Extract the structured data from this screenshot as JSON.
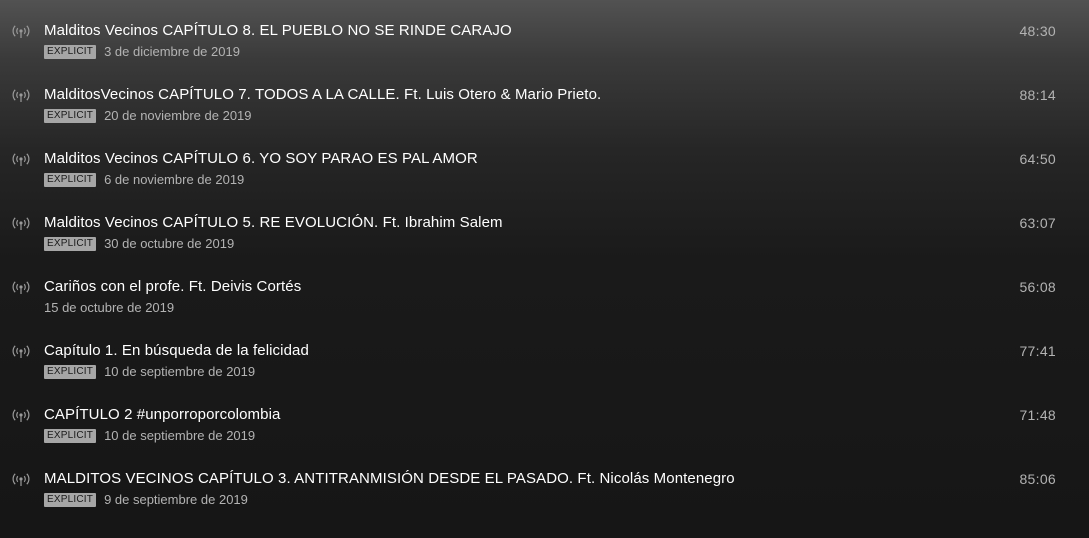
{
  "episodes": [
    {
      "title": "Malditos Vecinos CAPÍTULO 8. EL PUEBLO NO SE RINDE CARAJO",
      "explicit": true,
      "explicit_label": "EXPLICIT",
      "date": "3 de diciembre de 2019",
      "duration": "48:30"
    },
    {
      "title": "MalditosVecinos CAPÍTULO 7. TODOS A LA CALLE. Ft. Luis Otero & Mario Prieto.",
      "explicit": true,
      "explicit_label": "EXPLICIT",
      "date": "20 de noviembre de 2019",
      "duration": "88:14"
    },
    {
      "title": "Malditos Vecinos CAPÍTULO 6. YO SOY PARAO ES PAL AMOR",
      "explicit": true,
      "explicit_label": "EXPLICIT",
      "date": "6 de noviembre de 2019",
      "duration": "64:50"
    },
    {
      "title": "Malditos Vecinos CAPÍTULO 5. RE EVOLUCIÓN. Ft. Ibrahim Salem",
      "explicit": true,
      "explicit_label": "EXPLICIT",
      "date": "30 de octubre de 2019",
      "duration": "63:07"
    },
    {
      "title": "Cariños con el profe. Ft. Deivis Cortés",
      "explicit": false,
      "explicit_label": "",
      "date": "15 de octubre de 2019",
      "duration": "56:08"
    },
    {
      "title": "Capítulo 1. En búsqueda de la felicidad",
      "explicit": true,
      "explicit_label": "EXPLICIT",
      "date": "10 de septiembre de 2019",
      "duration": "77:41"
    },
    {
      "title": "CAPÍTULO 2 #unporroporcolombia",
      "explicit": true,
      "explicit_label": "EXPLICIT",
      "date": "10 de septiembre de 2019",
      "duration": "71:48"
    },
    {
      "title": "MALDITOS VECINOS CAPÍTULO 3. ANTITRANMISIÓN DESDE EL PASADO. Ft. Nicolás Montenegro",
      "explicit": true,
      "explicit_label": "EXPLICIT",
      "date": "9 de septiembre de 2019",
      "duration": "85:06"
    }
  ],
  "icons": {
    "row_icon": "podcast-broadcast-icon"
  },
  "colors": {
    "title_text": "#ffffff",
    "secondary_text": "#b3b3b3",
    "explicit_badge_bg": "#a6a6a6",
    "explicit_badge_text": "#1a1a1a",
    "background_dark": "#161616",
    "background_top": "#525252"
  }
}
